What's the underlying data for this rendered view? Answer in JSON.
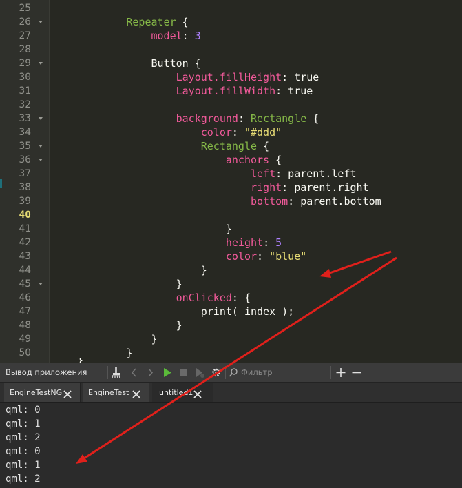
{
  "editor": {
    "current_line": 40,
    "lines": [
      {
        "num": "25",
        "fold": false,
        "indent": "",
        "tokens": []
      },
      {
        "num": "26",
        "fold": true,
        "indent": "            ",
        "tokens": [
          {
            "t": "Repeater",
            "c": "k"
          },
          {
            "t": " {",
            "c": "d"
          }
        ]
      },
      {
        "num": "27",
        "fold": false,
        "indent": "                ",
        "tokens": [
          {
            "t": "model",
            "c": "p"
          },
          {
            "t": ": ",
            "c": "d"
          },
          {
            "t": "3",
            "c": "n"
          }
        ]
      },
      {
        "num": "28",
        "fold": false,
        "indent": "",
        "tokens": []
      },
      {
        "num": "29",
        "fold": true,
        "indent": "                ",
        "tokens": [
          {
            "t": "Button",
            "c": "d"
          },
          {
            "t": " {",
            "c": "d"
          }
        ]
      },
      {
        "num": "30",
        "fold": false,
        "indent": "                    ",
        "tokens": [
          {
            "t": "Layout.fillHeight",
            "c": "p"
          },
          {
            "t": ": true",
            "c": "d"
          }
        ]
      },
      {
        "num": "31",
        "fold": false,
        "indent": "                    ",
        "tokens": [
          {
            "t": "Layout.fillWidth",
            "c": "p"
          },
          {
            "t": ": true",
            "c": "d"
          }
        ]
      },
      {
        "num": "32",
        "fold": false,
        "indent": "",
        "tokens": []
      },
      {
        "num": "33",
        "fold": true,
        "indent": "                    ",
        "tokens": [
          {
            "t": "background",
            "c": "p"
          },
          {
            "t": ": ",
            "c": "d"
          },
          {
            "t": "Rectangle",
            "c": "k"
          },
          {
            "t": " {",
            "c": "d"
          }
        ]
      },
      {
        "num": "34",
        "fold": false,
        "indent": "                        ",
        "tokens": [
          {
            "t": "color",
            "c": "p"
          },
          {
            "t": ": ",
            "c": "d"
          },
          {
            "t": "\"#ddd\"",
            "c": "s"
          }
        ]
      },
      {
        "num": "35",
        "fold": true,
        "indent": "                        ",
        "tokens": [
          {
            "t": "Rectangle",
            "c": "k"
          },
          {
            "t": " {",
            "c": "d"
          }
        ]
      },
      {
        "num": "36",
        "fold": true,
        "indent": "                            ",
        "tokens": [
          {
            "t": "anchors",
            "c": "p"
          },
          {
            "t": " {",
            "c": "d"
          }
        ]
      },
      {
        "num": "37",
        "fold": false,
        "indent": "                                ",
        "tokens": [
          {
            "t": "left",
            "c": "p"
          },
          {
            "t": ": parent.left",
            "c": "d"
          }
        ]
      },
      {
        "num": "38",
        "fold": false,
        "indent": "                                ",
        "tokens": [
          {
            "t": "right",
            "c": "p"
          },
          {
            "t": ": parent.right",
            "c": "d"
          }
        ]
      },
      {
        "num": "39",
        "fold": false,
        "indent": "                                ",
        "tokens": [
          {
            "t": "bottom",
            "c": "p"
          },
          {
            "t": ": parent.bottom",
            "c": "d"
          }
        ]
      },
      {
        "num": "40",
        "fold": false,
        "indent": "",
        "tokens": []
      },
      {
        "num": "41",
        "fold": false,
        "indent": "                            ",
        "tokens": [
          {
            "t": "}",
            "c": "d"
          }
        ]
      },
      {
        "num": "42",
        "fold": false,
        "indent": "                            ",
        "tokens": [
          {
            "t": "height",
            "c": "p"
          },
          {
            "t": ": ",
            "c": "d"
          },
          {
            "t": "5",
            "c": "n"
          }
        ]
      },
      {
        "num": "43",
        "fold": false,
        "indent": "                            ",
        "tokens": [
          {
            "t": "color",
            "c": "p"
          },
          {
            "t": ": ",
            "c": "d"
          },
          {
            "t": "\"blue\"",
            "c": "s"
          }
        ]
      },
      {
        "num": "44",
        "fold": false,
        "indent": "                        ",
        "tokens": [
          {
            "t": "}",
            "c": "d"
          }
        ]
      },
      {
        "num": "45",
        "fold": true,
        "indent": "                    ",
        "tokens": [
          {
            "t": "}",
            "c": "d"
          }
        ]
      },
      {
        "num": "46",
        "fold": false,
        "indent": "                    ",
        "tokens": [
          {
            "t": "onClicked",
            "c": "p"
          },
          {
            "t": ": {",
            "c": "d"
          }
        ]
      },
      {
        "num": "47",
        "fold": false,
        "indent": "                        ",
        "tokens": [
          {
            "t": "print( index );",
            "c": "d"
          }
        ]
      },
      {
        "num": "48",
        "fold": false,
        "indent": "                    ",
        "tokens": [
          {
            "t": "}",
            "c": "d"
          }
        ]
      },
      {
        "num": "49",
        "fold": false,
        "indent": "                ",
        "tokens": [
          {
            "t": "}",
            "c": "d"
          }
        ]
      },
      {
        "num": "50",
        "fold": false,
        "indent": "            ",
        "tokens": [
          {
            "t": "}",
            "c": "d"
          }
        ]
      }
    ]
  },
  "output_panel": {
    "title": "Вывод приложения",
    "filter_placeholder": "Фильтр",
    "tabs": [
      {
        "label": "EngineTestNG",
        "active": false
      },
      {
        "label": "EngineTest",
        "active": false
      },
      {
        "label": "untitled1",
        "active": true
      }
    ],
    "lines": [
      "qml: 0",
      "qml: 1",
      "qml: 2",
      "qml: 0",
      "qml: 1",
      "qml: 2"
    ]
  },
  "colors": {
    "arrow": "#e0201b",
    "run_button": "#5bbb3a"
  }
}
